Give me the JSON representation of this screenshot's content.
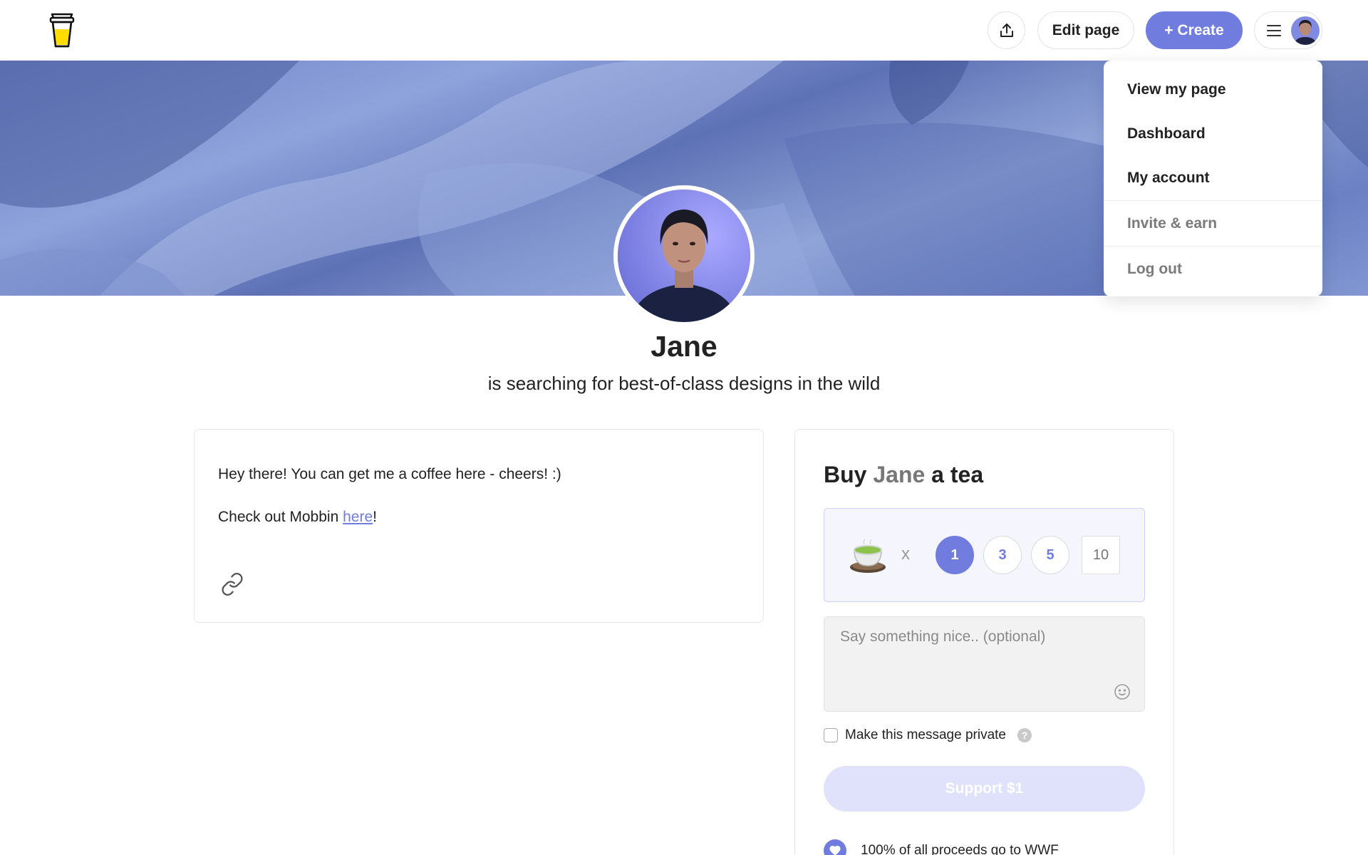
{
  "header": {
    "edit_label": "Edit page",
    "create_label": "+ Create"
  },
  "menu": {
    "items": [
      {
        "label": "View my page"
      },
      {
        "label": "Dashboard"
      },
      {
        "label": "My account"
      },
      {
        "label": "Invite & earn"
      },
      {
        "label": "Log out"
      }
    ]
  },
  "profile": {
    "name": "Jane",
    "tagline": "is searching for best-of-class designs in the wild"
  },
  "about": {
    "line1": "Hey there! You can get me a coffee here - cheers! :)",
    "line2_prefix": "Check out Mobbin ",
    "line2_link": "here",
    "line2_suffix": "!"
  },
  "support": {
    "title_prefix": "Buy ",
    "title_name": "Jane",
    "title_suffix": " a tea",
    "times": "x",
    "quantities": [
      "1",
      "3",
      "5"
    ],
    "selected_quantity": "1",
    "custom_quantity_placeholder": "10",
    "message_placeholder": "Say something nice.. (optional)",
    "private_label": "Make this message private",
    "help_glyph": "?",
    "button_label": "Support $1",
    "proceeds_text": "100% of all proceeds go to WWF"
  },
  "icons": {
    "logo": "buy-me-a-coffee-cup",
    "share": "share-upload-icon",
    "menu": "hamburger-icon",
    "link": "link-icon",
    "tea": "tea-cup-icon",
    "emoji": "smiley-icon",
    "proceeds": "heart-icon"
  },
  "colors": {
    "accent": "#717dde",
    "accent_light": "#dfe2fa",
    "qty_box_bg": "#f4f5fd",
    "text": "#222222",
    "muted": "#7a7a7a"
  }
}
